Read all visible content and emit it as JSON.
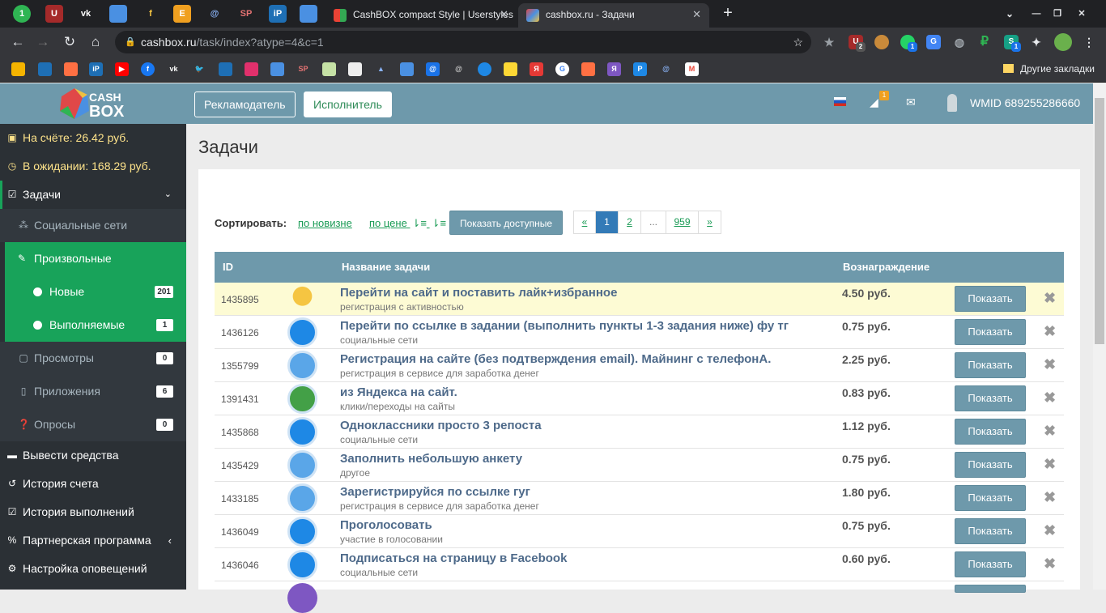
{
  "browser": {
    "tabs": [
      {
        "title": "CashBOX compact Style | Userstyles",
        "close": "✕"
      },
      {
        "title": "cashbox.ru - Задачи",
        "close": "✕"
      }
    ],
    "new_tab": "+",
    "address": {
      "host": "cashbox.ru",
      "path": "/task/index?atype=4&c=1"
    },
    "other_bookmarks": "Другие закладки",
    "ext_badges": [
      "2",
      "1",
      "1"
    ]
  },
  "header": {
    "advertiser_button": "Рекламодатель",
    "performer_button": "Исполнитель",
    "notif_count": "1",
    "wmid": "WMID 689255286660"
  },
  "sidebar": {
    "balance": "На счёте: 26.42 руб.",
    "pending": "В ожидании: 168.29 руб.",
    "tasks": "Задачи",
    "social": "Социальные сети",
    "custom": "Произвольные",
    "new": {
      "label": "Новые",
      "count": "201"
    },
    "in_progress": {
      "label": "Выполняемые",
      "count": "1"
    },
    "views": {
      "label": "Просмотры",
      "count": "0"
    },
    "apps": {
      "label": "Приложения",
      "count": "6"
    },
    "polls": {
      "label": "Опросы",
      "count": "0"
    },
    "withdraw": "Вывести средства",
    "account_history": "История счета",
    "completion_history": "История выполнений",
    "partner": "Партнерская программа",
    "notifications": "Настройка оповещений"
  },
  "main": {
    "title": "Задачи",
    "sort_label": "Сортировать:",
    "sort_new": "по новизне",
    "sort_price": "по цене",
    "show_available": "Показать доступные",
    "pager": [
      "«",
      "1",
      "2",
      "...",
      "959",
      "»"
    ],
    "columns": {
      "id": "ID",
      "name": "Название задачи",
      "reward": "Вознаграждение"
    },
    "show_label": "Показать",
    "rows": [
      {
        "id": "1435895",
        "title": "Перейти на сайт и поставить лайк+избранное",
        "cat": "регистрация с активностью",
        "price": "4.50 руб."
      },
      {
        "id": "1436126",
        "title": "Перейти по ссылке в задании (выполнить пункты 1-3 задания ниже) фу тг",
        "cat": "социальные сети",
        "price": "0.75 руб."
      },
      {
        "id": "1355799",
        "title": "Регистрация на сайте (без подтверждения email). Майнинг с телефонА.",
        "cat": "регистрация в сервисе для заработка денег",
        "price": "2.25 руб."
      },
      {
        "id": "1391431",
        "title": "из Яндекса на сайт.",
        "cat": "клики/переходы на сайты",
        "price": "0.83 руб."
      },
      {
        "id": "1435868",
        "title": "Одноклассники просто 3 репоста",
        "cat": "социальные сети",
        "price": "1.12 руб."
      },
      {
        "id": "1435429",
        "title": "Заполнить небольшую анкету",
        "cat": "другое",
        "price": "0.75 руб."
      },
      {
        "id": "1433185",
        "title": "Зарегистрируйся по ссылке гуг",
        "cat": "регистрация в сервисе для заработка денег",
        "price": "1.80 руб."
      },
      {
        "id": "1436049",
        "title": "Проголосовать",
        "cat": "участие в голосовании",
        "price": "0.75 руб."
      },
      {
        "id": "1436046",
        "title": "Подписаться на страницу в Facebook",
        "cat": "социальные сети",
        "price": "0.60 руб."
      }
    ]
  }
}
